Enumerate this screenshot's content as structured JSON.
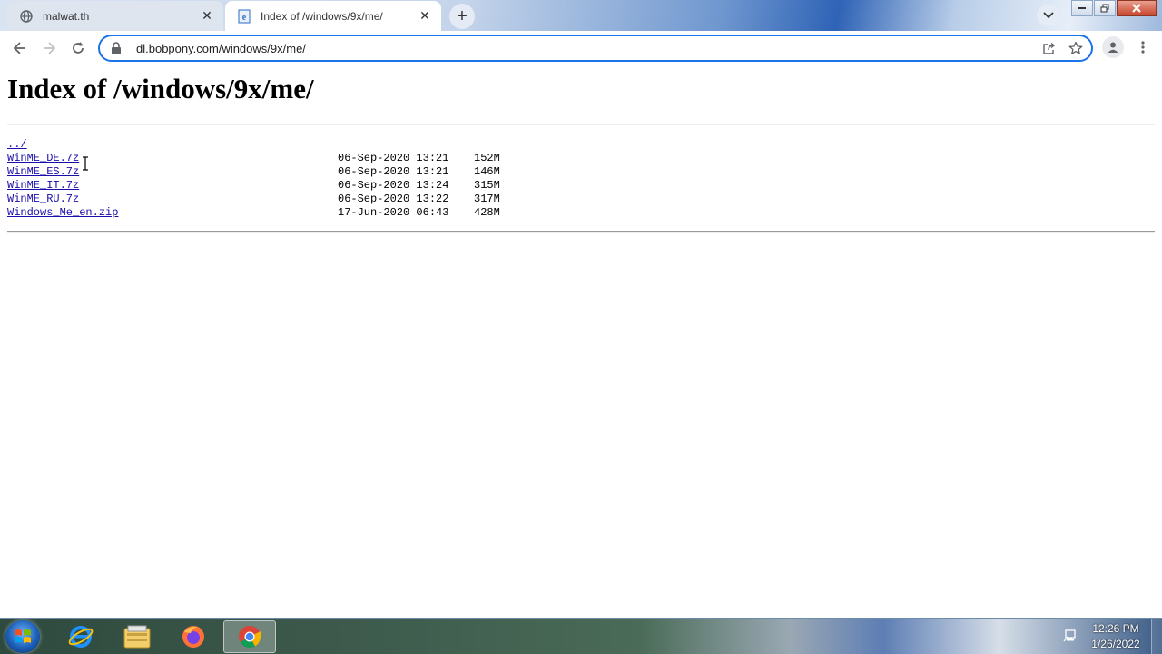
{
  "browser": {
    "tabs": [
      {
        "label": "malwat.th",
        "icon": "globe-icon",
        "active": false
      },
      {
        "label": "Index of /windows/9x/me/",
        "icon": "page-icon",
        "active": true
      }
    ],
    "new_tab_symbol": "+",
    "tab_close_symbol": "✕",
    "url": "dl.bobpony.com/windows/9x/me/"
  },
  "page": {
    "title": "Index of /windows/9x/me/",
    "parent_link": "../",
    "entries": [
      {
        "name": "WinME_DE.7z",
        "date": "06-Sep-2020 13:21",
        "size": "152M"
      },
      {
        "name": "WinME_ES.7z",
        "date": "06-Sep-2020 13:21",
        "size": "146M"
      },
      {
        "name": "WinME_IT.7z",
        "date": "06-Sep-2020 13:24",
        "size": "315M"
      },
      {
        "name": "WinME_RU.7z",
        "date": "06-Sep-2020 13:22",
        "size": "317M"
      },
      {
        "name": "Windows_Me_en.zip",
        "date": "17-Jun-2020 06:43",
        "size": "428M"
      }
    ]
  },
  "taskbar": {
    "apps": [
      "internet-explorer-icon",
      "file-explorer-icon",
      "firefox-icon",
      "chrome-icon"
    ],
    "active_app": "chrome-icon",
    "time": "12:26 PM",
    "date": "1/26/2022"
  },
  "colors": {
    "link": "#1a0dab",
    "omnibox_focus": "#1a73e8"
  }
}
